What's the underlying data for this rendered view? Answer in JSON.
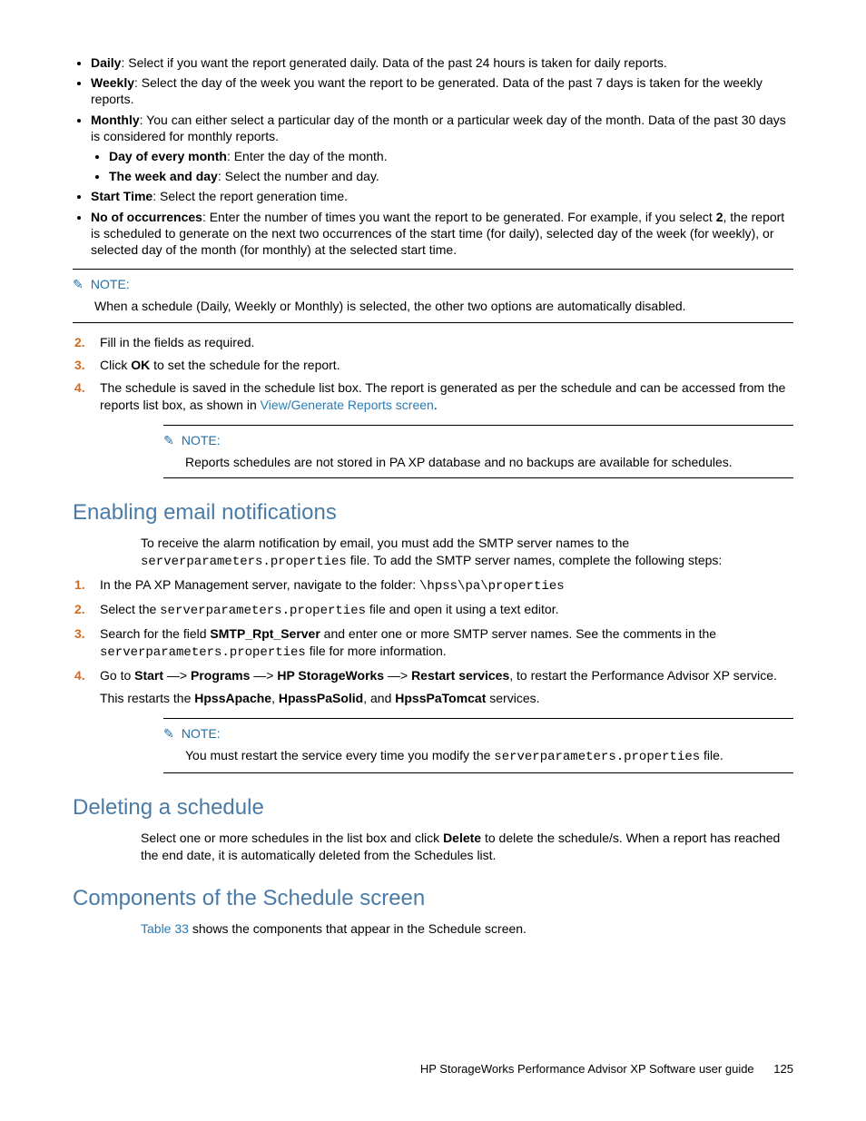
{
  "top_list": {
    "daily_label": "Daily",
    "daily_text": ": Select if you want the report generated daily. Data of the past 24 hours is taken for daily reports.",
    "weekly_label": "Weekly",
    "weekly_text": ": Select the day of the week you want the report to be generated. Data of the past 7 days is taken for the weekly reports.",
    "monthly_label": "Monthly",
    "monthly_text": ": You can either select a particular day of the month or a particular week day of the month. Data of the past 30 days is considered for monthly reports.",
    "monthly_sub1_label": "Day of every month",
    "monthly_sub1_text": ": Enter the day of the month.",
    "monthly_sub2_label": "The week and day",
    "monthly_sub2_text": ": Select the number and day.",
    "start_label": "Start Time",
    "start_text": ": Select the report generation time.",
    "occur_label": "No of occurrences",
    "occur_text_a": ": Enter the number of times you want the report to be generated. For example, if you select ",
    "occur_text_b": "2",
    "occur_text_c": ", the report is scheduled to generate on the next two occurrences of the start time (for daily), selected day of the week (for weekly), or selected day of the month (for monthly) at the selected start time."
  },
  "note1": {
    "label": "NOTE:",
    "body": "When a schedule (Daily, Weekly or Monthly) is selected, the other two options are automatically disabled."
  },
  "steps1": {
    "s2": "Fill in the fields as required.",
    "s3_a": "Click ",
    "s3_b": "OK",
    "s3_c": " to set the schedule for the report.",
    "s4_a": "The schedule is saved in the schedule list box. The report is generated as per the schedule and can be accessed from the reports list box, as shown in ",
    "s4_link": "View/Generate Reports screen",
    "s4_b": "."
  },
  "note2": {
    "label": "NOTE:",
    "body": "Reports schedules are not stored in PA XP database and no backups are available for schedules."
  },
  "sec1": {
    "title": "Enabling email notifications",
    "intro_a": "To receive the alarm notification by email, you must add the SMTP server names to the ",
    "intro_code": "serverparameters.properties",
    "intro_b": " file. To add the SMTP server names, complete the following steps:",
    "step1_a": "In the PA XP Management server, navigate to the folder: ",
    "step1_code": "\\hpss\\pa\\properties",
    "step2_a": "Select the ",
    "step2_code": "serverparameters.properties",
    "step2_b": " file and open it using a text editor.",
    "step3_a": "Search for the field ",
    "step3_bold": "SMTP_Rpt_Server",
    "step3_b": " and enter one or more SMTP server names. See the comments in the ",
    "step3_code": "serverparameters.properties",
    "step3_c": " file for more information.",
    "step4_a": "Go to ",
    "step4_b1": "Start",
    "step4_arr": " —> ",
    "step4_b2": "Programs",
    "step4_b3": "HP StorageWorks",
    "step4_b4": "Restart services",
    "step4_c": ", to restart the Performance Advisor XP service.",
    "step4_para_a": "This restarts the ",
    "step4_para_b1": "HpssApache",
    "step4_para_sep": ", ",
    "step4_para_b2": "HpassPaSolid",
    "step4_para_and": ", and ",
    "step4_para_b3": "HpssPaTomcat",
    "step4_para_c": " services."
  },
  "note3": {
    "label": "NOTE:",
    "body_a": "You must restart the service every time you modify the ",
    "body_code": "serverparameters.properties",
    "body_b": " file."
  },
  "sec2": {
    "title": "Deleting a schedule",
    "body_a": "Select one or more schedules in the list box and click ",
    "body_bold": "Delete",
    "body_b": " to delete the schedule/s. When a report has reached the end date, it is automatically deleted from the Schedules list."
  },
  "sec3": {
    "title": "Components of the Schedule screen",
    "body_link": "Table 33",
    "body_b": " shows the components that appear in the Schedule screen."
  },
  "footer": {
    "text": "HP StorageWorks Performance Advisor XP Software user guide",
    "page": "125"
  }
}
